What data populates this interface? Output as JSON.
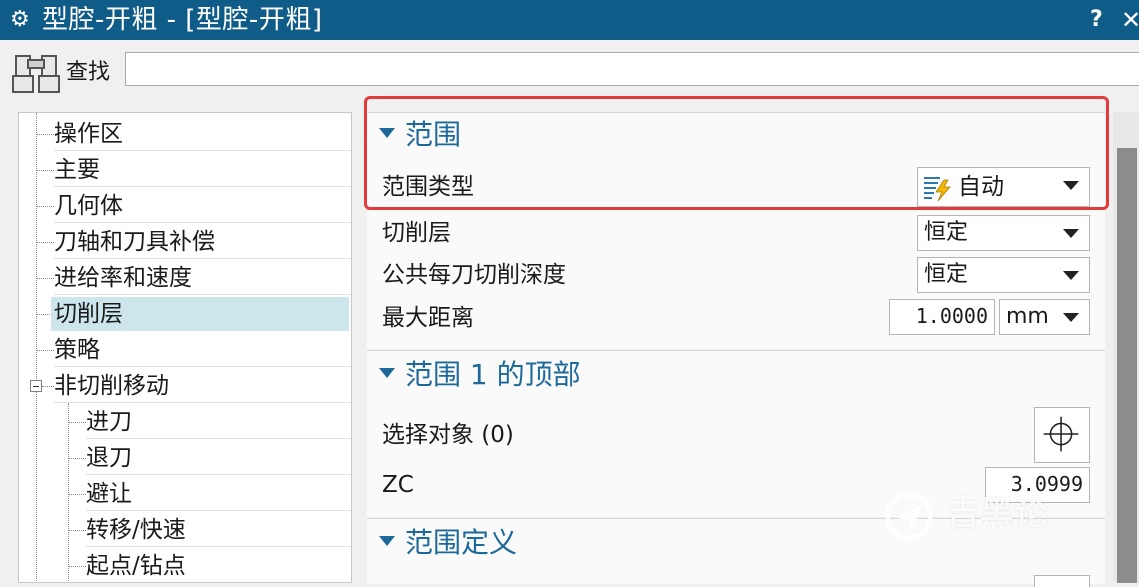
{
  "window": {
    "title": "型腔-开粗 - [型腔-开粗]",
    "help_label": "?",
    "close_label": "✕"
  },
  "find": {
    "label": "查找",
    "value": ""
  },
  "tree": {
    "items": [
      {
        "label": "操作区"
      },
      {
        "label": "主要"
      },
      {
        "label": "几何体"
      },
      {
        "label": "刀轴和刀具补偿"
      },
      {
        "label": "进给率和速度"
      },
      {
        "label": "切削层",
        "selected": true
      },
      {
        "label": "策略"
      },
      {
        "label": "非切削移动"
      },
      {
        "label": "进刀"
      },
      {
        "label": "退刀"
      },
      {
        "label": "避让"
      },
      {
        "label": "转移/快速"
      },
      {
        "label": "起点/钻点"
      }
    ]
  },
  "range": {
    "title": "范围",
    "range_type_label": "范围类型",
    "range_type_value": "自动",
    "cut_levels_label": "切削层",
    "cut_levels_value": "恒定",
    "common_depth_label": "公共每刀切削深度",
    "common_depth_value": "恒定",
    "max_distance_label": "最大距离",
    "max_distance_value": "1.0000",
    "max_distance_unit": "mm"
  },
  "range_top": {
    "title": "范围 1 的顶部",
    "select_label": "选择对象 (0)",
    "zc_label": "ZC",
    "zc_value": "3.0999"
  },
  "range_def": {
    "title": "范围定义"
  },
  "watermark": "吉黑论",
  "colors": {
    "title_bar": "#0f5c88",
    "section_header": "#1d6a9a",
    "selected_row": "#cde6ec",
    "highlight_box": "#e23b3b"
  }
}
